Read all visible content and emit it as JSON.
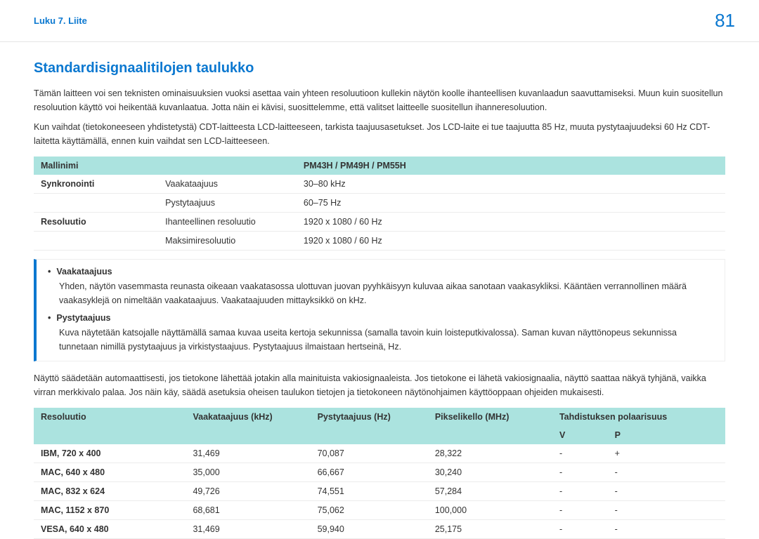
{
  "header": {
    "breadcrumb": "Luku 7. Liite",
    "page_number": "81"
  },
  "section_title": "Standardisignaalitilojen taulukko",
  "paragraphs": {
    "p1": "Tämän laitteen voi sen teknisten ominaisuuksien vuoksi asettaa vain yhteen resoluutioon kullekin näytön koolle ihanteellisen kuvanlaadun saavuttamiseksi. Muun kuin suositellun resoluution käyttö voi heikentää kuvanlaatua. Jotta näin ei kävisi, suosittelemme, että valitset laitteelle suositellun ihanneresoluution.",
    "p2": "Kun vaihdat (tietokoneeseen yhdistetystä) CDT-laitteesta LCD-laitteeseen, tarkista taajuusasetukset. Jos LCD-laite ei tue taajuutta 85 Hz, muuta pystytaajuudeksi 60 Hz CDT-laitetta käyttämällä, ennen kuin vaihdat sen LCD-laitteeseen.",
    "p3": "Näyttö säädetään automaattisesti, jos tietokone lähettää jotakin alla mainituista vakiosignaaleista. Jos tietokone ei lähetä vakiosignaalia, näyttö saattaa näkyä tyhjänä, vaikka virran merkkivalo palaa. Jos näin käy, säädä asetuksia oheisen taulukon tietojen ja tietokoneen näytönohjaimen käyttöoppaan ohjeiden mukaisesti."
  },
  "spec_table": {
    "header_left": "Mallinimi",
    "header_right": "PM43H / PM49H / PM55H",
    "rows": [
      {
        "group": "Synkronointi",
        "label": "Vaakataajuus",
        "value": "30–80 kHz"
      },
      {
        "group": "",
        "label": "Pystytaajuus",
        "value": "60–75 Hz"
      },
      {
        "group": "Resoluutio",
        "label": "Ihanteellinen resoluutio",
        "value": "1920 x 1080 / 60 Hz"
      },
      {
        "group": "",
        "label": "Maksimiresoluutio",
        "value": "1920 x 1080 / 60 Hz"
      }
    ]
  },
  "notes": [
    {
      "title": "Vaakataajuus",
      "body": "Yhden, näytön vasemmasta reunasta oikeaan vaakatasossa ulottuvan juovan pyyhkäisyyn kuluvaa aikaa sanotaan vaakasykliksi. Kääntäen verrannollinen määrä vaakasyklejä on nimeltään vaakataajuus. Vaakataajuuden mittayksikkö on kHz."
    },
    {
      "title": "Pystytaajuus",
      "body": "Kuva näytetään katsojalle näyttämällä samaa kuvaa useita kertoja sekunnissa (samalla tavoin kuin loisteputkivalossa). Saman kuvan näyttönopeus sekunnissa tunnetaan nimillä pystytaajuus ja virkistystaajuus. Pystytaajuus ilmaistaan hertseinä, Hz."
    }
  ],
  "res_table": {
    "headers": {
      "c1": "Resoluutio",
      "c2": "Vaakataajuus (kHz)",
      "c3": "Pystytaajuus (Hz)",
      "c4": "Pikselikello (MHz)",
      "c5": "Tahdistuksen polaarisuus",
      "c5a": "V",
      "c5b": "P"
    },
    "rows": [
      {
        "c1": "IBM, 720 x 400",
        "c2": "31,469",
        "c3": "70,087",
        "c4": "28,322",
        "c5a": "-",
        "c5b": "+"
      },
      {
        "c1": "MAC, 640 x 480",
        "c2": "35,000",
        "c3": "66,667",
        "c4": "30,240",
        "c5a": "-",
        "c5b": "-"
      },
      {
        "c1": "MAC, 832 x 624",
        "c2": "49,726",
        "c3": "74,551",
        "c4": "57,284",
        "c5a": "-",
        "c5b": "-"
      },
      {
        "c1": "MAC, 1152 x 870",
        "c2": "68,681",
        "c3": "75,062",
        "c4": "100,000",
        "c5a": "-",
        "c5b": "-"
      },
      {
        "c1": "VESA, 640 x 480",
        "c2": "31,469",
        "c3": "59,940",
        "c4": "25,175",
        "c5a": "-",
        "c5b": "-"
      }
    ]
  }
}
